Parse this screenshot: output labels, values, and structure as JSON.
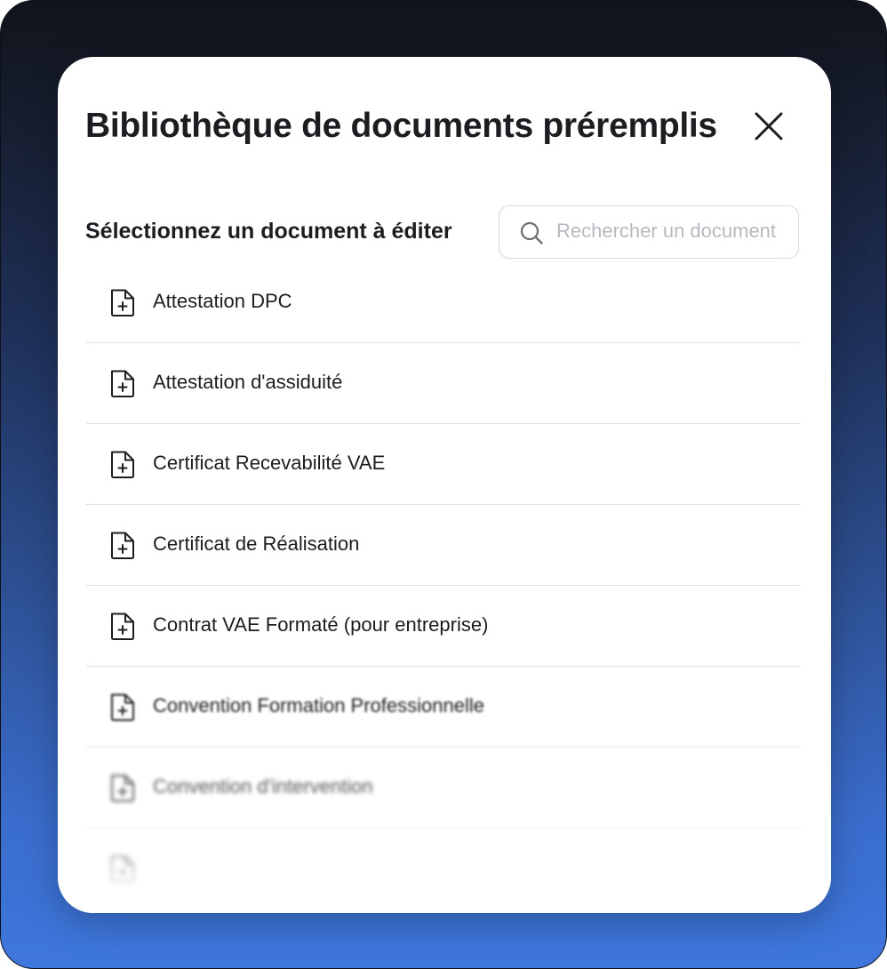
{
  "modal": {
    "title": "Bibliothèque de documents préremplis",
    "subtitle": "Sélectionnez un document à éditer",
    "close_icon": "close-icon"
  },
  "search": {
    "placeholder": "Rechercher un document",
    "value": "",
    "icon": "search-icon"
  },
  "documents": [
    {
      "label": "Attestation DPC",
      "icon": "file-plus-icon"
    },
    {
      "label": "Attestation d'assiduité",
      "icon": "file-plus-icon"
    },
    {
      "label": "Certificat Recevabilité VAE",
      "icon": "file-plus-icon"
    },
    {
      "label": "Certificat de Réalisation",
      "icon": "file-plus-icon"
    },
    {
      "label": "Contrat VAE Formaté (pour entreprise)",
      "icon": "file-plus-icon"
    },
    {
      "label": "Convention Formation Professionnelle",
      "icon": "file-plus-icon"
    },
    {
      "label": "Convention d'intervention",
      "icon": "file-plus-icon"
    },
    {
      "label": "",
      "icon": "file-plus-icon"
    }
  ],
  "colors": {
    "background_top": "#11141b",
    "background_bottom": "#3e77dd",
    "text": "#1c1d21",
    "divider": "#dfe2e6",
    "placeholder": "#b6b9bf"
  }
}
